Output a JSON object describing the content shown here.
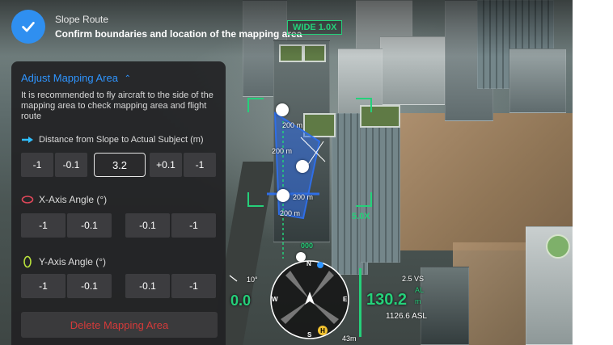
{
  "header": {
    "route_type": "Slope Route",
    "instruction": "Confirm boundaries and location of the mapping area"
  },
  "panel": {
    "title": "Adjust Mapping Area",
    "description": "It is recommended to fly aircraft to the side of the mapping area to check mapping area and flight route",
    "distance": {
      "label": "Distance from Slope to Actual Subject (m)",
      "buttons": [
        "-1",
        "-0.1",
        "+0.1",
        "-1"
      ],
      "value": "3.2"
    },
    "x_axis": {
      "label": "X-Axis Angle (°)",
      "buttons": [
        "-1",
        "-0.1",
        "-0.1",
        "-1"
      ]
    },
    "y_axis": {
      "label": "Y-Axis Angle (°)",
      "buttons": [
        "-1",
        "-0.1",
        "-0.1",
        "-1"
      ]
    },
    "delete_label": "Delete Mapping Area"
  },
  "camera": {
    "wide_label": "WIDE 1.0X",
    "zoom_label": "5.0X"
  },
  "map_labels": {
    "distances": [
      "200 m",
      "200 m",
      "200 m",
      "200 m"
    ],
    "distance_marker": "000"
  },
  "hud": {
    "horizontal_speed": "0.0",
    "pitch_readout": "10°",
    "altitude": "130.2",
    "vertical_speed": "2.5 VS",
    "al_label": "AL",
    "al_unit": "m",
    "asl": "1126.6 ASL",
    "home_distance": "43m",
    "compass": {
      "n": "N",
      "w": "W",
      "e": "E",
      "s": "S"
    }
  },
  "colors": {
    "accent_blue": "#2f95ff",
    "hud_green": "#25d07a",
    "danger_red": "#d43a3a",
    "panel_bg": "#222224"
  }
}
